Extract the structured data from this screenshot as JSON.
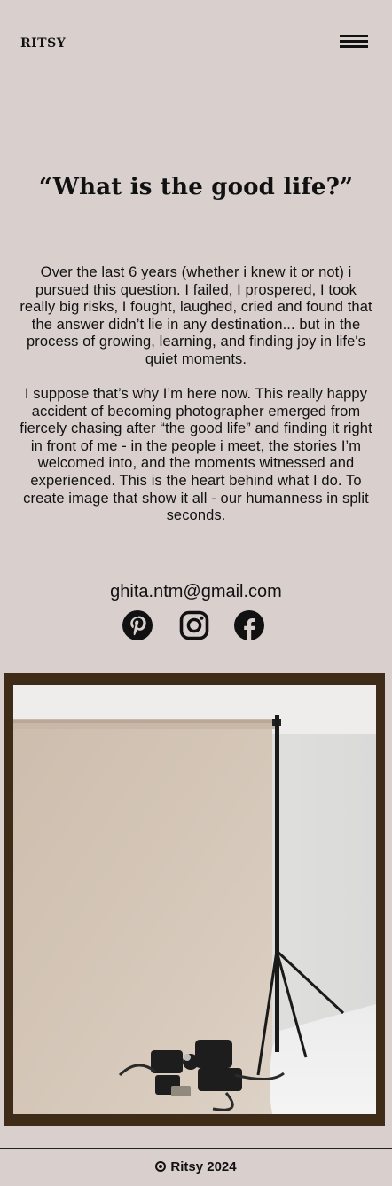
{
  "header": {
    "brand": "RITSY",
    "menu_icon": "hamburger-menu-icon"
  },
  "main": {
    "quote": "“What is the good life?”",
    "paragraph_1": "Over the last 6 years (whether i knew it or not) i pursued this question. I failed, I prospered, I took really big risks, I fought, laughed, cried and found that the answer didn’t lie in any destination... but in the process of growing, learning, and finding joy in life's quiet moments.",
    "paragraph_2": "I suppose that’s why I’m here now. This really happy accident of becoming photographer emerged from fiercely chasing after “the good life” and finding it right in front of me - in the people i meet, the stories I’m welcomed into, and the moments witnessed and experienced. This is the heart behind what I do. To create image that show it all - our humanness in split seconds.",
    "email": "ghita.ntm@gmail.com",
    "socials": [
      {
        "name": "pinterest",
        "icon": "pinterest-icon"
      },
      {
        "name": "instagram",
        "icon": "instagram-icon"
      },
      {
        "name": "facebook",
        "icon": "facebook-icon"
      }
    ]
  },
  "colors": {
    "background": "#d9d0cd",
    "frame": "#3e2b18",
    "text": "#111111"
  },
  "footer": {
    "icon": "copyright-circle-icon",
    "text": "Ritsy 2024"
  }
}
